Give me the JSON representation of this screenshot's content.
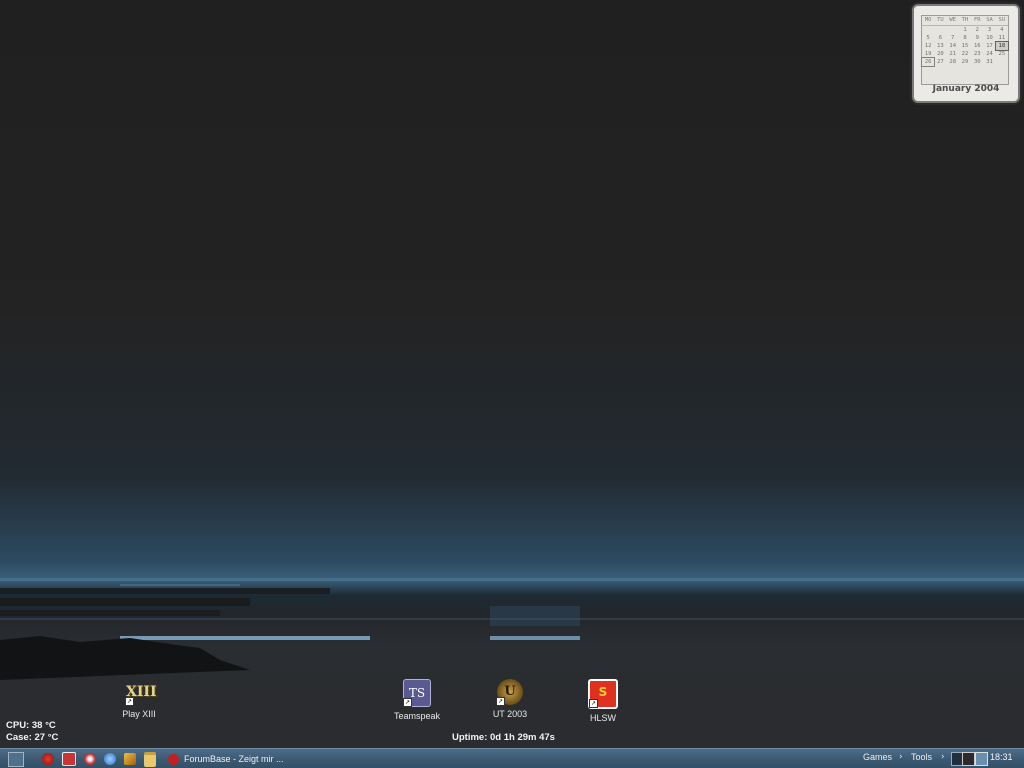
{
  "calendar": {
    "weekdays": [
      "MO",
      "TU",
      "WE",
      "TH",
      "FR",
      "SA",
      "SU"
    ],
    "weeks": [
      [
        "",
        "",
        "",
        "1",
        "2",
        "3",
        "4"
      ],
      [
        "5",
        "6",
        "7",
        "8",
        "9",
        "10",
        "11"
      ],
      [
        "12",
        "13",
        "14",
        "15",
        "16",
        "17",
        "18"
      ],
      [
        "19",
        "20",
        "21",
        "22",
        "23",
        "24",
        "25"
      ],
      [
        "26",
        "27",
        "28",
        "29",
        "30",
        "31",
        ""
      ]
    ],
    "today": "18",
    "marked": "26",
    "title": "January 2004"
  },
  "desktop_icons": [
    {
      "label": "Play XIII",
      "glyph": "XIII",
      "icon": "xiii-game-icon"
    },
    {
      "label": "Teamspeak",
      "glyph": "TS",
      "icon": "teamspeak-icon"
    },
    {
      "label": "UT 2003",
      "glyph": "U",
      "icon": "ut2003-icon"
    },
    {
      "label": "HLSW",
      "glyph": "S",
      "icon": "hlsw-icon"
    }
  ],
  "stats": {
    "cpu": "CPU: 38 °C",
    "case": "Case: 27 °C",
    "uptime": "Uptime: 0d 1h 29m 47s"
  },
  "taskbar": {
    "task_label": "ForumBase - Zeigt mir ...",
    "menu_games": "Games",
    "menu_tools": "Tools",
    "arrow": "›",
    "clock": "18:31"
  },
  "colors": {
    "taskbar": "#3c5a73",
    "horizon_glow": "#6d9bbd"
  }
}
